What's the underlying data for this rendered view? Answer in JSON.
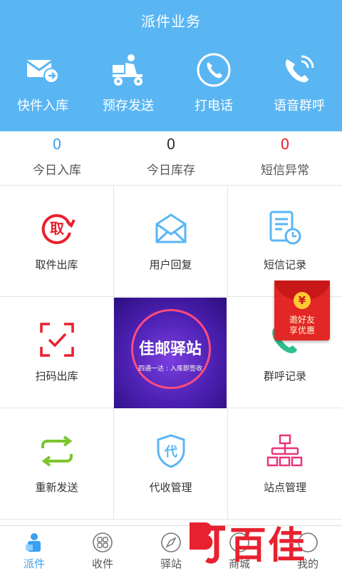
{
  "header": {
    "title": "派件业务"
  },
  "quick_actions": [
    {
      "label": "快件入库",
      "icon": "envelope-scan-icon"
    },
    {
      "label": "预存发送",
      "icon": "courier-scooter-icon"
    },
    {
      "label": "打电话",
      "icon": "phone-icon"
    },
    {
      "label": "语音群呼",
      "icon": "phone-broadcast-icon"
    }
  ],
  "stats": [
    {
      "value": "0",
      "label": "今日入库",
      "color": "#3aa0f0"
    },
    {
      "value": "0",
      "label": "今日库存",
      "color": "#333333"
    },
    {
      "value": "0",
      "label": "短信异常",
      "color": "#e8212f"
    }
  ],
  "grid": [
    {
      "label": "取件出库",
      "icon": "pickup-icon"
    },
    {
      "label": "用户回复",
      "icon": "mail-icon"
    },
    {
      "label": "短信记录",
      "icon": "sms-record-icon"
    },
    {
      "label": "扫码出库",
      "icon": "scan-icon"
    },
    {
      "label": "群呼记录",
      "icon": "call-record-icon"
    },
    {
      "label": "重新发送",
      "icon": "resend-icon"
    },
    {
      "label": "代收管理",
      "icon": "proxy-shield-icon"
    },
    {
      "label": "站点管理",
      "icon": "station-org-icon"
    }
  ],
  "promo": {
    "brand": "佳邮驿站",
    "slogan": "四通一达 : 入库即签收",
    "pickup_glyph": "取",
    "proxy_glyph": "代"
  },
  "red_packet": {
    "line1": "邀好友",
    "line2": "享优惠",
    "coin": "¥"
  },
  "tabs": [
    {
      "label": "派件",
      "active": true
    },
    {
      "label": "收件",
      "active": false
    },
    {
      "label": "驿站",
      "active": false
    },
    {
      "label": "商城",
      "active": false
    },
    {
      "label": "我的",
      "active": false
    }
  ],
  "watermark": {
    "text": "百佳"
  },
  "colors": {
    "header_bg": "#5ab6f3",
    "accent": "#3aa0f0",
    "danger": "#e8212f"
  }
}
